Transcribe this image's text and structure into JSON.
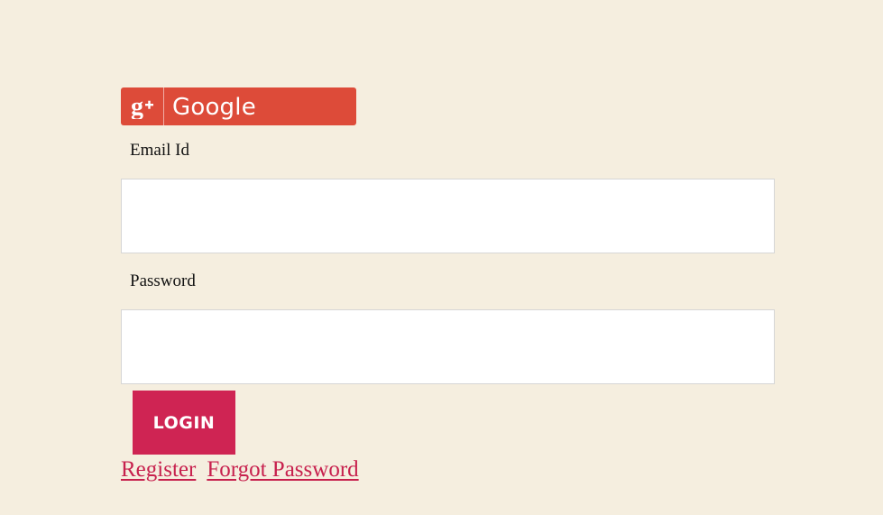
{
  "colors": {
    "page_background": "#f5eedf",
    "google_red": "#dd4b39",
    "login_crimson": "#cf2453",
    "link_color": "#c7204d"
  },
  "google_button": {
    "icon": "google-plus-icon",
    "label": "Google"
  },
  "form": {
    "email_label": "Email Id",
    "email_value": "",
    "password_label": "Password",
    "password_value": "",
    "login_label": "LOGIN"
  },
  "links": {
    "register": "Register",
    "forgot_password": "Forgot Password"
  }
}
